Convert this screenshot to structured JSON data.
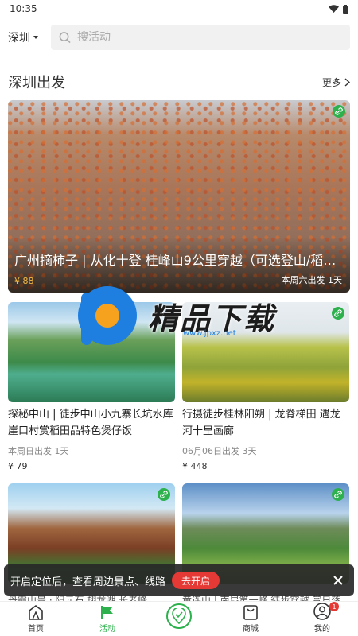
{
  "status_bar": {
    "time": "10:35"
  },
  "header": {
    "city": "深圳",
    "search_placeholder": "搜活动"
  },
  "section": {
    "title": "深圳出发",
    "more_label": "更多"
  },
  "hero": {
    "title": "广州摘柿子 | 从化十登 桂峰山9公里穿越（可选登山/稻田...",
    "price": "¥ 88",
    "date": "本周六出发 1天"
  },
  "cards": [
    {
      "title": "探秘中山 | 徒步中山小九寨长坑水库 崖口村赏稻田品特色煲仔饭",
      "date": "本周日出发 1天",
      "price": "¥ 79"
    },
    {
      "title": "行摄徒步桂林阳朔 | 龙脊梯田 遇龙河十里画廊",
      "date": "06月06日出发 3天",
      "price": "¥ 448"
    },
    {
      "title": "丹霞山景 · 阳元石 翔龙湖 长老峰",
      "date": "",
      "price": ""
    },
    {
      "title": "黄连山 | 南昆第一峰 徒步穿越 赏日落",
      "date": "",
      "price": ""
    }
  ],
  "watermark": {
    "text": "精品下载",
    "url": "www.jpxz.net"
  },
  "toast": {
    "text": "开启定位后，查看周边景点、线路",
    "button": "去开启"
  },
  "tabs": [
    {
      "label": "首页"
    },
    {
      "label": "活动"
    },
    {
      "label": ""
    },
    {
      "label": "商城"
    },
    {
      "label": "我的"
    }
  ],
  "profile_badge": "1",
  "colors": {
    "accent": "#2db14d",
    "toast_button": "#e53935",
    "price_hero": "#f5b942"
  }
}
